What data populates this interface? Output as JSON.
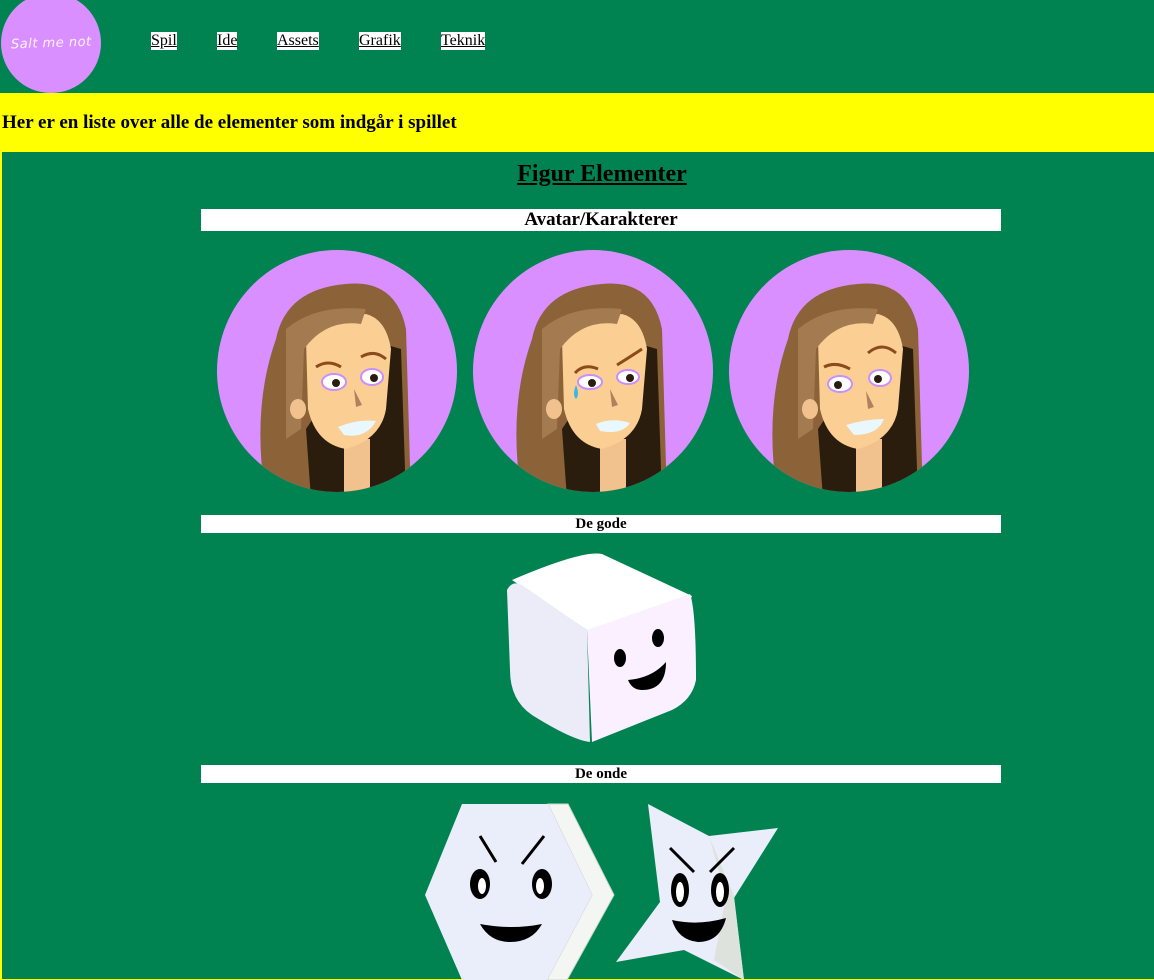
{
  "logo": {
    "text": "Salt me not"
  },
  "nav": {
    "items": [
      {
        "label": "Spil"
      },
      {
        "label": "Ide"
      },
      {
        "label": "Assets"
      },
      {
        "label": "Grafik"
      },
      {
        "label": "Teknik"
      }
    ]
  },
  "banner": {
    "text": "Her er en liste over alle de elementer som indgår i spillet"
  },
  "main": {
    "title": "Figur Elementer",
    "sections": [
      {
        "label": "Avatar/Karakterer"
      },
      {
        "label": "De gode"
      },
      {
        "label": "De onde"
      }
    ]
  },
  "colors": {
    "green": "#008350",
    "yellow": "#ffff00",
    "purple": "#d98fff",
    "white": "#ffffff"
  },
  "icons": [
    "avatar-happy-image",
    "avatar-crying-image",
    "avatar-smiling-image",
    "sugar-cube-image",
    "salt-hexagon-image",
    "salt-star-image"
  ]
}
